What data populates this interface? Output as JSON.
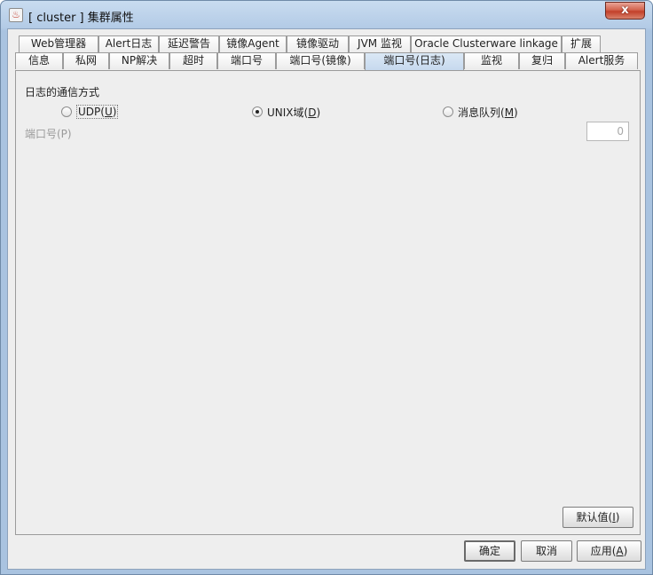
{
  "window": {
    "title": "[ cluster ] 集群属性",
    "close_glyph": "x"
  },
  "tabs": {
    "row1": [
      "Web管理器",
      "Alert日志",
      "延迟警告",
      "镜像Agent",
      "镜像驱动",
      "JVM 监视",
      "Oracle Clusterware linkage",
      "扩展"
    ],
    "row2": [
      "信息",
      "私网",
      "NP解决",
      "超时",
      "端口号",
      "端口号(镜像)",
      "端口号(日志)",
      "监视",
      "复归",
      "Alert服务"
    ],
    "selected": "端口号(日志)"
  },
  "panel": {
    "group_label": "日志的通信方式",
    "radios": [
      {
        "label": "UDP(",
        "mnemonic": "U",
        "suffix": ")",
        "checked": false
      },
      {
        "label": "UNIX域(",
        "mnemonic": "D",
        "suffix": ")",
        "checked": true
      },
      {
        "label": "消息队列(",
        "mnemonic": "M",
        "suffix": ")",
        "checked": false
      }
    ],
    "port_label": "端口号(P)",
    "port_value": "0",
    "default_button": {
      "label": "默认值(",
      "mnemonic": "I",
      "suffix": ")"
    }
  },
  "footer": {
    "ok": "确定",
    "cancel": "取消",
    "apply": {
      "label": "应用(",
      "mnemonic": "A",
      "suffix": ")"
    }
  }
}
